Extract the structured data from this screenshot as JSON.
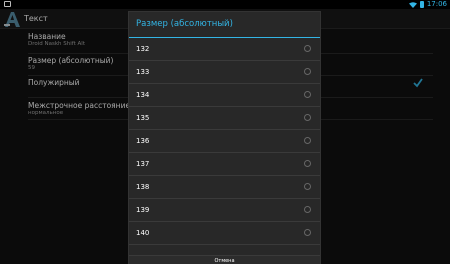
{
  "statusbar": {
    "time": "17:06",
    "accent": "#33b5e5"
  },
  "actionbar": {
    "title": "Текст",
    "icon": "app-logo-icon"
  },
  "settings": [
    {
      "title": "Название",
      "summary": "Droid Naskh Shift Alt"
    },
    {
      "title": "Размер (абсолютный)",
      "summary": "59"
    },
    {
      "title": "Полужирный",
      "summary": "",
      "checked": true
    },
    {
      "title": "Межстрочное расстояние",
      "summary": "нормальное"
    }
  ],
  "dialog": {
    "title": "Размер (абсолютный)",
    "items": [
      "132",
      "133",
      "134",
      "135",
      "136",
      "137",
      "138",
      "139",
      "140"
    ],
    "cancel_label": "Отмена"
  }
}
